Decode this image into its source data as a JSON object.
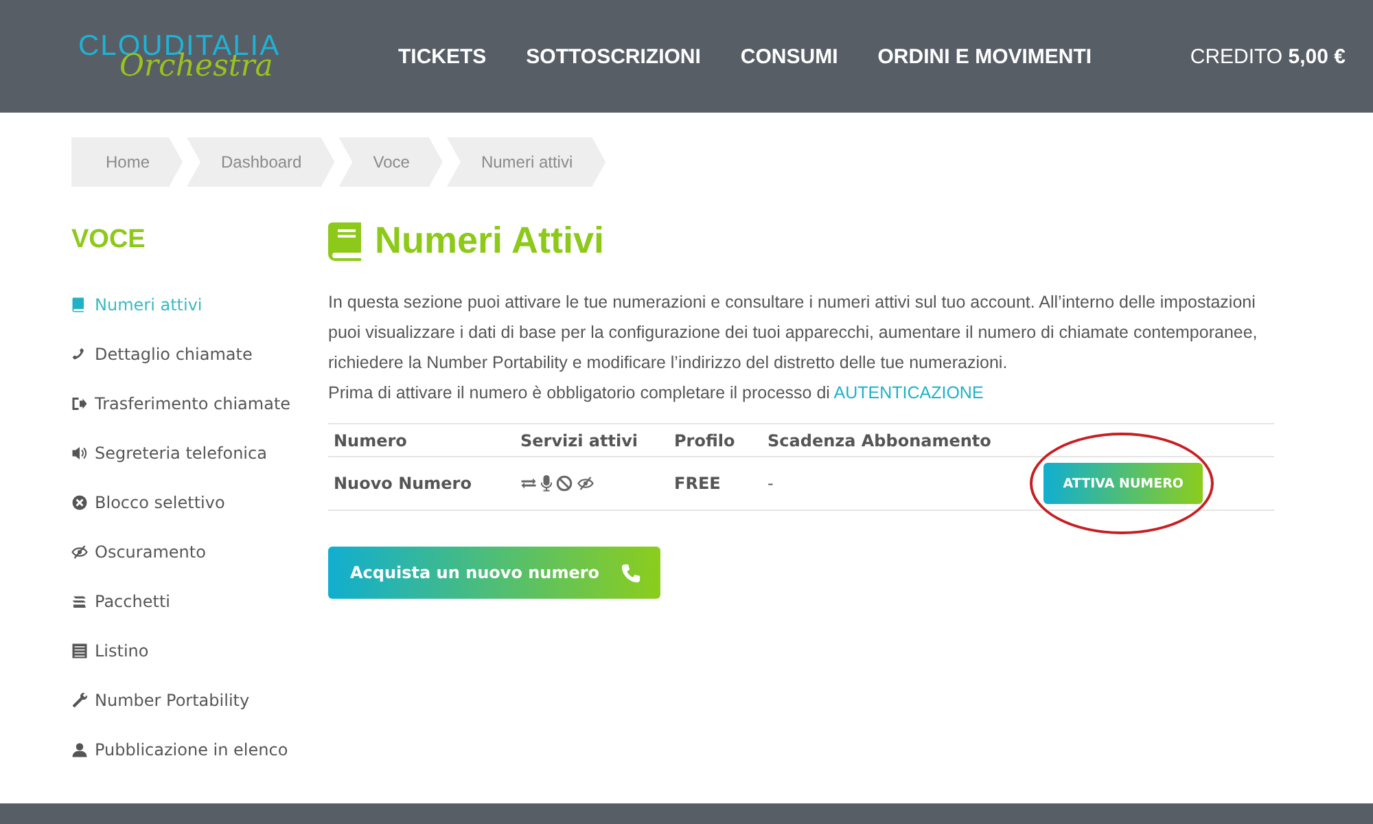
{
  "header": {
    "logo": {
      "brand": "CLOUDITALIA",
      "product": "Orchestra"
    },
    "nav": [
      {
        "label": "TICKETS"
      },
      {
        "label": "SOTTOSCRIZIONI"
      },
      {
        "label": "CONSUMI"
      },
      {
        "label": "ORDINI E MOVIMENTI"
      }
    ],
    "credit": {
      "label": "CREDITO",
      "amount": "5,00 €"
    }
  },
  "breadcrumb": [
    "Home",
    "Dashboard",
    "Voce",
    "Numeri attivi"
  ],
  "sidebar": {
    "title": "VOCE",
    "items": [
      {
        "label": "Numeri attivi",
        "selected": true
      },
      {
        "label": "Dettaglio chiamate",
        "selected": false
      },
      {
        "label": "Trasferimento chiamate",
        "selected": false
      },
      {
        "label": "Segreteria telefonica",
        "selected": false
      },
      {
        "label": "Blocco selettivo",
        "selected": false
      },
      {
        "label": "Oscuramento",
        "selected": false
      },
      {
        "label": "Pacchetti",
        "selected": false
      },
      {
        "label": "Listino",
        "selected": false
      },
      {
        "label": "Number Portability",
        "selected": false
      },
      {
        "label": "Pubblicazione in elenco",
        "selected": false
      }
    ]
  },
  "main": {
    "title": "Numeri Attivi",
    "intro": "In questa sezione puoi attivare le tue numerazioni e consultare i numeri attivi sul tuo account. All’interno delle impostazioni puoi visualizzare i dati di base per la configurazione dei tuoi apparecchi, aumentare il numero di chiamate contemporanee, richiedere la Number Portability e modificare l’indirizzo del distretto delle tue numerazioni.",
    "notice": "Prima di attivare il numero è obbligatorio completare il processo di",
    "notice_link": "AUTENTICAZIONE",
    "table": {
      "columns": [
        "Numero",
        "Servizi attivi",
        "Profilo",
        "Scadenza Abbonamento"
      ],
      "rows": [
        {
          "numero": "Nuovo Numero",
          "profilo": "FREE",
          "scadenza": "-",
          "action": "ATTIVA NUMERO",
          "highlighted": true
        }
      ]
    },
    "buy_button": "Acquista un nuovo numero"
  }
}
